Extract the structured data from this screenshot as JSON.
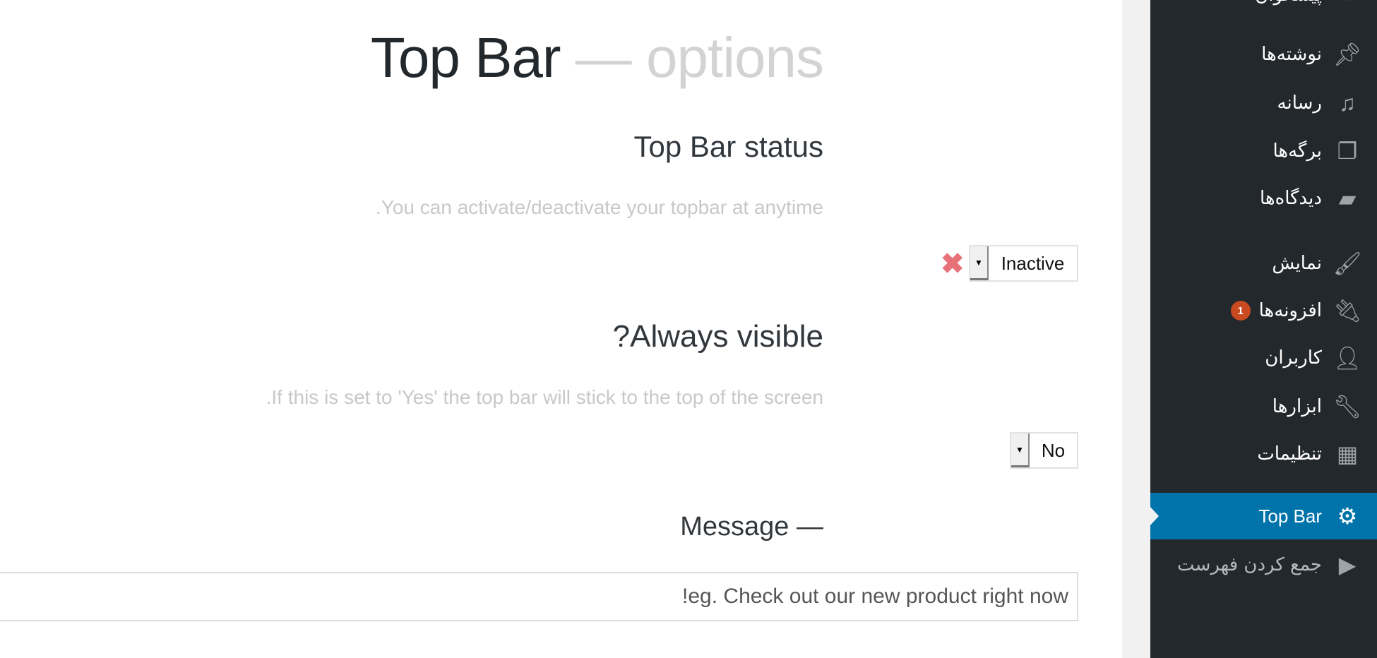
{
  "page": {
    "title_main": "Top Bar",
    "title_sub": "— options",
    "status": {
      "heading": "Top Bar status",
      "description": "You can activate/deactivate your topbar at anytime.",
      "value": "Inactive",
      "status_icon": "red-x-icon",
      "status_color": "#e8727a"
    },
    "visible": {
      "heading": "Always visible?",
      "description": "If this is set to 'Yes' the top bar will stick to the top of the screen.",
      "value": "No"
    },
    "message": {
      "heading": "— Message",
      "placeholder": "eg. Check out our new product right now!"
    }
  },
  "sidebar": {
    "accent": "#0073aa",
    "items": [
      {
        "label": "پیشخوان",
        "icon": "dashboard-icon"
      },
      {
        "label": "نوشته‌ها",
        "icon": "pin-icon"
      },
      {
        "label": "رسانه",
        "icon": "media-icon"
      },
      {
        "label": "برگه‌ها",
        "icon": "pages-icon"
      },
      {
        "label": "دیدگاه‌ها",
        "icon": "comment-icon"
      },
      {
        "label": "نمایش",
        "icon": "brush-icon"
      },
      {
        "label": "افزونه‌ها",
        "icon": "plugin-icon",
        "badge": "1"
      },
      {
        "label": "کاربران",
        "icon": "user-icon"
      },
      {
        "label": "ابزارها",
        "icon": "wrench-icon"
      },
      {
        "label": "تنظیمات",
        "icon": "settings-icon"
      },
      {
        "label": "Top Bar",
        "icon": "gear-icon",
        "active": true
      },
      {
        "label": "جمع کردن فهرست",
        "icon": "collapse-icon"
      }
    ]
  }
}
